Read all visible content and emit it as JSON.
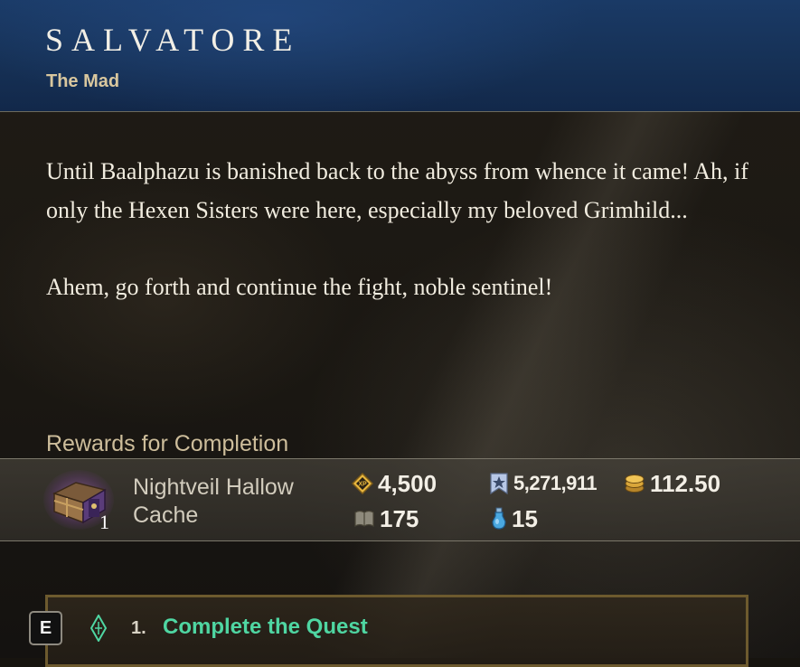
{
  "npc": {
    "name": "SALVATORE",
    "title": "The Mad"
  },
  "dialogue": {
    "paragraphs": [
      "Until Baalphazu is banished back to the abyss from whence it came! Ah, if only the Hexen Sisters were here, especially my beloved Grimhild...",
      "Ahem, go forth and continue the fight, noble sentinel!"
    ]
  },
  "rewards": {
    "label": "Rewards for Completion",
    "item": {
      "name": "Nightveil Hallow Cache",
      "count": "1",
      "icon": "treasure-chest-icon"
    },
    "stats": [
      {
        "id": "xp",
        "icon": "xp-icon",
        "value": "4,500"
      },
      {
        "id": "azoth",
        "icon": "standing-icon",
        "value": "5,271,911"
      },
      {
        "id": "coin",
        "icon": "coin-icon",
        "value": "112.50"
      },
      {
        "id": "faction",
        "icon": "faction-icon",
        "value": "175"
      },
      {
        "id": "azoth-vial",
        "icon": "azoth-vial-icon",
        "value": "15"
      }
    ]
  },
  "objective": {
    "key": "E",
    "number": "1.",
    "text": "Complete the Quest",
    "icon": "quest-diamond-icon"
  },
  "colors": {
    "header_blue": "#163156",
    "objective_green": "#4fd6a2",
    "title_gold": "#d9c79e"
  }
}
